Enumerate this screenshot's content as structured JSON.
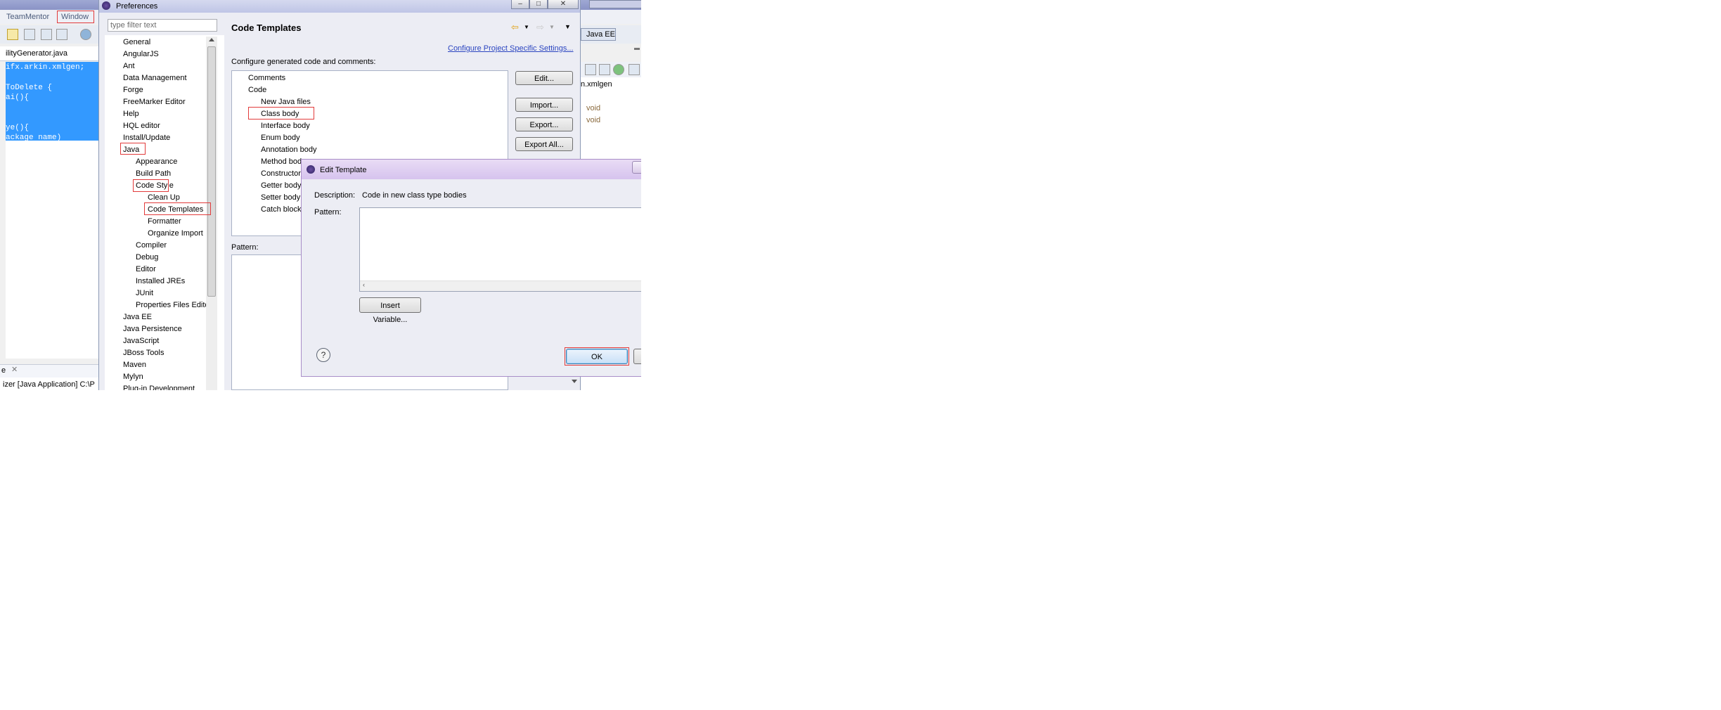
{
  "ide": {
    "menu": {
      "team_mentor": "TeamMentor",
      "window": "Window"
    },
    "editor_tab": "ilityGenerator.java",
    "code_lines": [
      "ifx.arkin.xmlgen;",
      "",
      "ToDelete {",
      "ai(){",
      "",
      "",
      "ye(){",
      "ackage name)"
    ],
    "perspective_label": "Java EE",
    "outline_package": "n.xmlgen",
    "outline_items": [
      "void",
      "void"
    ],
    "console_tab": "e",
    "console_text": "izer [Java Application] C:\\P"
  },
  "prefs": {
    "title": "Preferences",
    "filter_placeholder": "type filter text",
    "page_title": "Code Templates",
    "configure_link": "Configure Project Specific Settings...",
    "configure_label": "Configure generated code and comments:",
    "pattern_label": "Pattern:",
    "tree": [
      {
        "label": "General",
        "level": 0
      },
      {
        "label": "AngularJS",
        "level": 0
      },
      {
        "label": "Ant",
        "level": 0
      },
      {
        "label": "Data Management",
        "level": 0
      },
      {
        "label": "Forge",
        "level": 0
      },
      {
        "label": "FreeMarker Editor",
        "level": 0
      },
      {
        "label": "Help",
        "level": 0
      },
      {
        "label": "HQL editor",
        "level": 0
      },
      {
        "label": "Install/Update",
        "level": 0
      },
      {
        "label": "Java",
        "level": 0
      },
      {
        "label": "Appearance",
        "level": 1
      },
      {
        "label": "Build Path",
        "level": 1
      },
      {
        "label": "Code Style",
        "level": 1
      },
      {
        "label": "Clean Up",
        "level": 2
      },
      {
        "label": "Code Templates",
        "level": 2
      },
      {
        "label": "Formatter",
        "level": 2
      },
      {
        "label": "Organize Import",
        "level": 2
      },
      {
        "label": "Compiler",
        "level": 1
      },
      {
        "label": "Debug",
        "level": 1
      },
      {
        "label": "Editor",
        "level": 1
      },
      {
        "label": "Installed JREs",
        "level": 1
      },
      {
        "label": "JUnit",
        "level": 1
      },
      {
        "label": "Properties Files Edito",
        "level": 1
      },
      {
        "label": "Java EE",
        "level": 0
      },
      {
        "label": "Java Persistence",
        "level": 0
      },
      {
        "label": "JavaScript",
        "level": 0
      },
      {
        "label": "JBoss Tools",
        "level": 0
      },
      {
        "label": "Maven",
        "level": 0
      },
      {
        "label": "Mylyn",
        "level": 0
      },
      {
        "label": "Plug-in Development",
        "level": 0
      }
    ],
    "templates": [
      {
        "label": "Comments",
        "level": 0
      },
      {
        "label": "Code",
        "level": 0
      },
      {
        "label": "New Java files",
        "level": 1
      },
      {
        "label": "Class body",
        "level": 1
      },
      {
        "label": "Interface body",
        "level": 1
      },
      {
        "label": "Enum body",
        "level": 1
      },
      {
        "label": "Annotation body",
        "level": 1
      },
      {
        "label": "Method body",
        "level": 1
      },
      {
        "label": "Constructor body",
        "level": 1
      },
      {
        "label": "Getter body",
        "level": 1
      },
      {
        "label": "Setter body",
        "level": 1
      },
      {
        "label": "Catch block body",
        "level": 1
      }
    ],
    "buttons": {
      "edit": "Edit...",
      "import": "Import...",
      "export": "Export...",
      "export_all": "Export All..."
    }
  },
  "edit_dialog": {
    "title": "Edit Template",
    "description_label": "Description:",
    "description_value": "Code in new class type bodies",
    "pattern_label": "Pattern:",
    "insert_variable": "Insert Variable...",
    "ok": "OK",
    "help": "?"
  }
}
